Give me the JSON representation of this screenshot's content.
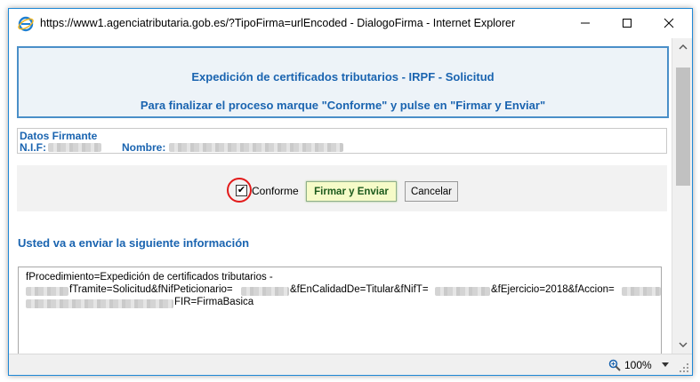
{
  "window": {
    "title": "https://www1.agenciatributaria.gob.es/?TipoFirma=urlEncoded - DialogoFirma - Internet Explorer"
  },
  "header": {
    "line1": "Expedición de certificados tributarios - IRPF - Solicitud",
    "line2": "Para finalizar el proceso marque \"Conforme\" y pulse en \"Firmar y Enviar\""
  },
  "signer": {
    "title": "Datos Firmante",
    "nif_label": "N.I.F:",
    "name_label": "Nombre:"
  },
  "actions": {
    "checkbox_label": "Conforme",
    "checkbox_checked": true,
    "sign_button": "Firmar y Enviar",
    "cancel_button": "Cancelar"
  },
  "info": {
    "heading": "Usted va a enviar la siguiente información",
    "line1": "fProcedimiento=Expedición de certificados tributarios -",
    "line2_a": "fTramite=Solicitud&fNifPeticionario=",
    "line2_b": "&fEnCalidadDe=Titular&fNifT=",
    "line2_c": "&fEjercicio=2018&fAccion=",
    "line3": "FIR=FirmaBasica"
  },
  "status": {
    "zoom": "100%"
  },
  "colors": {
    "accent": "#1a64b0",
    "highlight_circle": "#e21a1a",
    "sign_button_bg": "#f6fbc8"
  }
}
